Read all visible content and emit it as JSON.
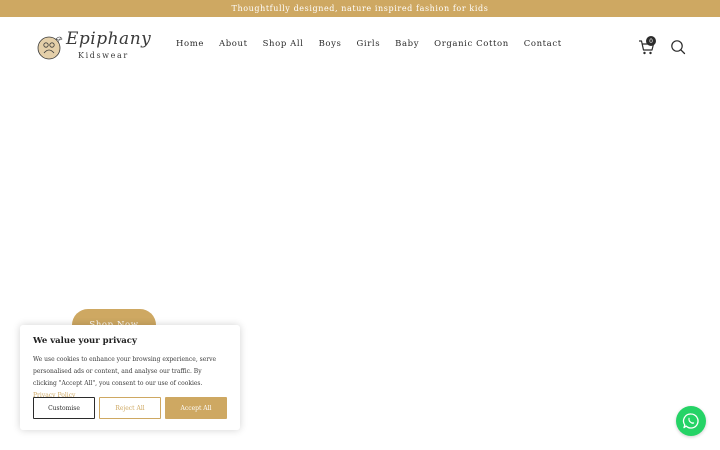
{
  "announcement": {
    "text": "Thoughtfully designed, nature inspired fashion for kids"
  },
  "brand": {
    "name": "Epiphany",
    "sub": "Kidswear"
  },
  "nav": {
    "items": [
      {
        "label": "Home"
      },
      {
        "label": "About"
      },
      {
        "label": "Shop All"
      },
      {
        "label": "Boys"
      },
      {
        "label": "Girls"
      },
      {
        "label": "Baby"
      },
      {
        "label": "Organic Cotton"
      },
      {
        "label": "Contact"
      }
    ]
  },
  "cart": {
    "count": "0",
    "icon": "cart-icon"
  },
  "search": {
    "icon": "search-icon"
  },
  "hero": {
    "cta_label": "Shop Now"
  },
  "consent": {
    "title": "We value your privacy",
    "text": "We use cookies to enhance your browsing experience, serve personalised ads or content, and analyse our traffic. By clicking \"Accept All\", you consent to our use of cookies.",
    "policy_link": "Privacy Policy",
    "customise_label": "Customise",
    "reject_label": "Reject All",
    "accept_label": "Accept All"
  },
  "whatsapp": {
    "icon": "whatsapp-icon"
  },
  "colors": {
    "accent": "#cea862",
    "dark": "#2b2b2b",
    "whatsapp": "#25d366"
  }
}
